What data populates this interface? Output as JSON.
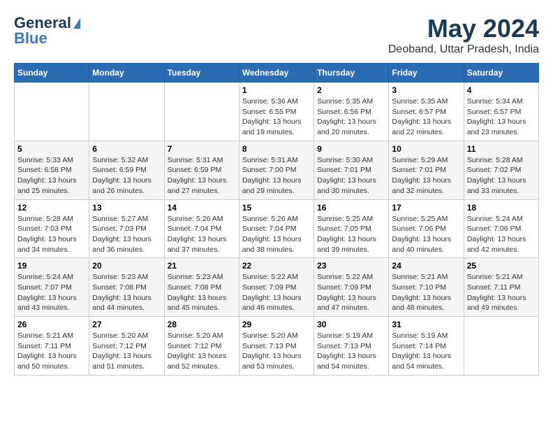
{
  "header": {
    "logo_line1": "General",
    "logo_line2": "Blue",
    "title": "May 2024",
    "subtitle": "Deoband, Uttar Pradesh, India"
  },
  "calendar": {
    "days_of_week": [
      "Sunday",
      "Monday",
      "Tuesday",
      "Wednesday",
      "Thursday",
      "Friday",
      "Saturday"
    ],
    "weeks": [
      [
        {
          "day": "",
          "info": ""
        },
        {
          "day": "",
          "info": ""
        },
        {
          "day": "",
          "info": ""
        },
        {
          "day": "1",
          "info": "Sunrise: 5:36 AM\nSunset: 6:55 PM\nDaylight: 13 hours\nand 19 minutes."
        },
        {
          "day": "2",
          "info": "Sunrise: 5:35 AM\nSunset: 6:56 PM\nDaylight: 13 hours\nand 20 minutes."
        },
        {
          "day": "3",
          "info": "Sunrise: 5:35 AM\nSunset: 6:57 PM\nDaylight: 13 hours\nand 22 minutes."
        },
        {
          "day": "4",
          "info": "Sunrise: 5:34 AM\nSunset: 6:57 PM\nDaylight: 13 hours\nand 23 minutes."
        }
      ],
      [
        {
          "day": "5",
          "info": "Sunrise: 5:33 AM\nSunset: 6:58 PM\nDaylight: 13 hours\nand 25 minutes."
        },
        {
          "day": "6",
          "info": "Sunrise: 5:32 AM\nSunset: 6:59 PM\nDaylight: 13 hours\nand 26 minutes."
        },
        {
          "day": "7",
          "info": "Sunrise: 5:31 AM\nSunset: 6:59 PM\nDaylight: 13 hours\nand 27 minutes."
        },
        {
          "day": "8",
          "info": "Sunrise: 5:31 AM\nSunset: 7:00 PM\nDaylight: 13 hours\nand 29 minutes."
        },
        {
          "day": "9",
          "info": "Sunrise: 5:30 AM\nSunset: 7:01 PM\nDaylight: 13 hours\nand 30 minutes."
        },
        {
          "day": "10",
          "info": "Sunrise: 5:29 AM\nSunset: 7:01 PM\nDaylight: 13 hours\nand 32 minutes."
        },
        {
          "day": "11",
          "info": "Sunrise: 5:28 AM\nSunset: 7:02 PM\nDaylight: 13 hours\nand 33 minutes."
        }
      ],
      [
        {
          "day": "12",
          "info": "Sunrise: 5:28 AM\nSunset: 7:03 PM\nDaylight: 13 hours\nand 34 minutes."
        },
        {
          "day": "13",
          "info": "Sunrise: 5:27 AM\nSunset: 7:03 PM\nDaylight: 13 hours\nand 36 minutes."
        },
        {
          "day": "14",
          "info": "Sunrise: 5:26 AM\nSunset: 7:04 PM\nDaylight: 13 hours\nand 37 minutes."
        },
        {
          "day": "15",
          "info": "Sunrise: 5:26 AM\nSunset: 7:04 PM\nDaylight: 13 hours\nand 38 minutes."
        },
        {
          "day": "16",
          "info": "Sunrise: 5:25 AM\nSunset: 7:05 PM\nDaylight: 13 hours\nand 39 minutes."
        },
        {
          "day": "17",
          "info": "Sunrise: 5:25 AM\nSunset: 7:06 PM\nDaylight: 13 hours\nand 40 minutes."
        },
        {
          "day": "18",
          "info": "Sunrise: 5:24 AM\nSunset: 7:06 PM\nDaylight: 13 hours\nand 42 minutes."
        }
      ],
      [
        {
          "day": "19",
          "info": "Sunrise: 5:24 AM\nSunset: 7:07 PM\nDaylight: 13 hours\nand 43 minutes."
        },
        {
          "day": "20",
          "info": "Sunrise: 5:23 AM\nSunset: 7:08 PM\nDaylight: 13 hours\nand 44 minutes."
        },
        {
          "day": "21",
          "info": "Sunrise: 5:23 AM\nSunset: 7:08 PM\nDaylight: 13 hours\nand 45 minutes."
        },
        {
          "day": "22",
          "info": "Sunrise: 5:22 AM\nSunset: 7:09 PM\nDaylight: 13 hours\nand 46 minutes."
        },
        {
          "day": "23",
          "info": "Sunrise: 5:22 AM\nSunset: 7:09 PM\nDaylight: 13 hours\nand 47 minutes."
        },
        {
          "day": "24",
          "info": "Sunrise: 5:21 AM\nSunset: 7:10 PM\nDaylight: 13 hours\nand 48 minutes."
        },
        {
          "day": "25",
          "info": "Sunrise: 5:21 AM\nSunset: 7:11 PM\nDaylight: 13 hours\nand 49 minutes."
        }
      ],
      [
        {
          "day": "26",
          "info": "Sunrise: 5:21 AM\nSunset: 7:11 PM\nDaylight: 13 hours\nand 50 minutes."
        },
        {
          "day": "27",
          "info": "Sunrise: 5:20 AM\nSunset: 7:12 PM\nDaylight: 13 hours\nand 51 minutes."
        },
        {
          "day": "28",
          "info": "Sunrise: 5:20 AM\nSunset: 7:12 PM\nDaylight: 13 hours\nand 52 minutes."
        },
        {
          "day": "29",
          "info": "Sunrise: 5:20 AM\nSunset: 7:13 PM\nDaylight: 13 hours\nand 53 minutes."
        },
        {
          "day": "30",
          "info": "Sunrise: 5:19 AM\nSunset: 7:13 PM\nDaylight: 13 hours\nand 54 minutes."
        },
        {
          "day": "31",
          "info": "Sunrise: 5:19 AM\nSunset: 7:14 PM\nDaylight: 13 hours\nand 54 minutes."
        },
        {
          "day": "",
          "info": ""
        }
      ]
    ]
  }
}
